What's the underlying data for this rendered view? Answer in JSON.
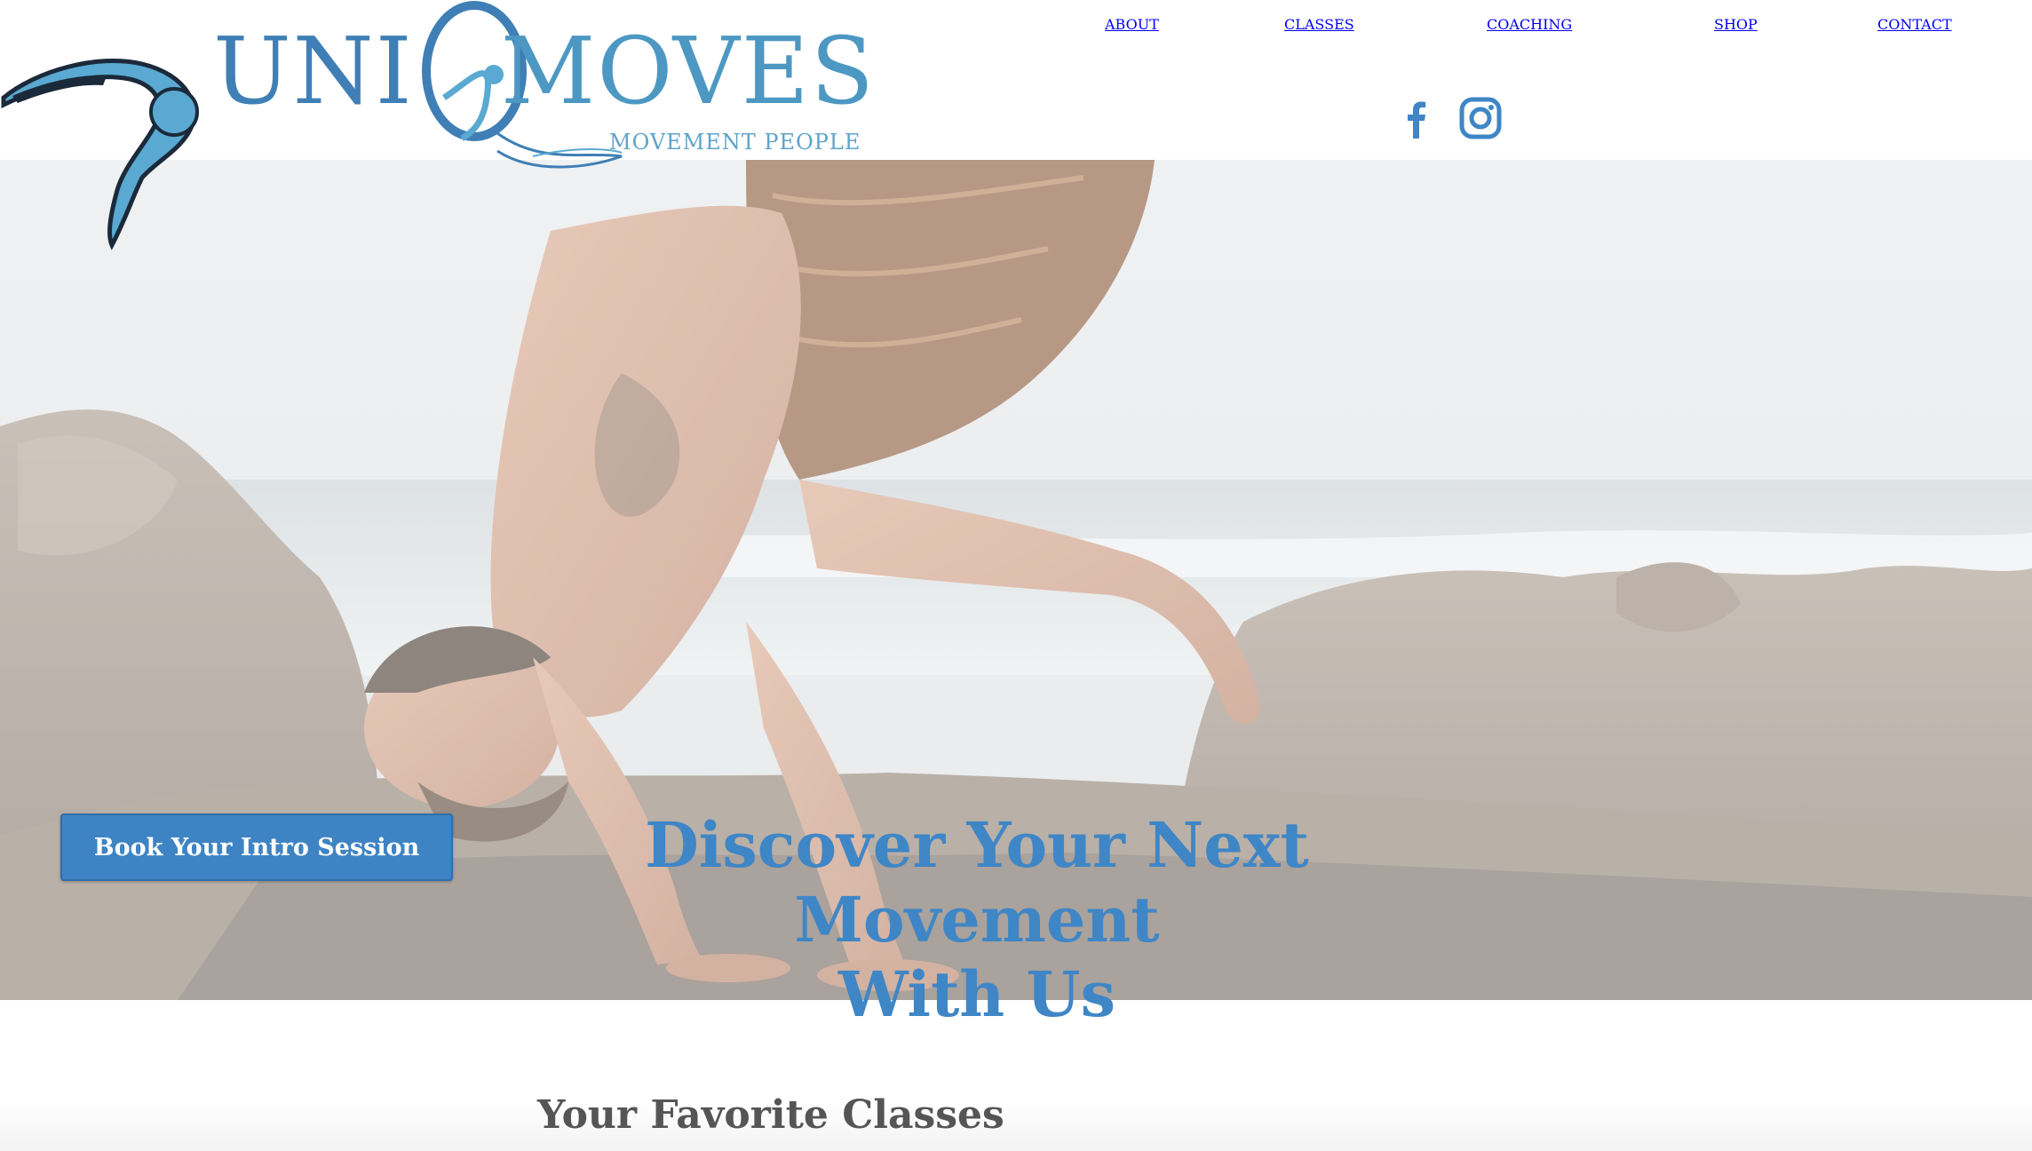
{
  "brand": {
    "name_left": "UNI",
    "name_right": "MOVES",
    "tagline": "MOVEMENT PEOPLE",
    "logo_mark": "dancer-swoosh-logo",
    "primary_color": "#3f7fb6",
    "accent_color": "#4d98c2"
  },
  "nav": {
    "items": [
      {
        "label": "ABOUT"
      },
      {
        "label": "CLASSES"
      },
      {
        "label": "COACHING"
      },
      {
        "label": "SHOP"
      },
      {
        "label": "CONTACT"
      }
    ]
  },
  "social": {
    "icons": [
      "facebook-icon",
      "instagram-icon"
    ],
    "color": "#3f86c6"
  },
  "hero": {
    "image": "man-crow-pose-on-beach-rocks",
    "cta_label": "Book Your Intro Session",
    "headline_line1": "Discover Your Next Movement",
    "headline_line2": "With Us",
    "cta_color": "#3e84c4"
  },
  "section": {
    "title": "Your Favorite Classes"
  }
}
